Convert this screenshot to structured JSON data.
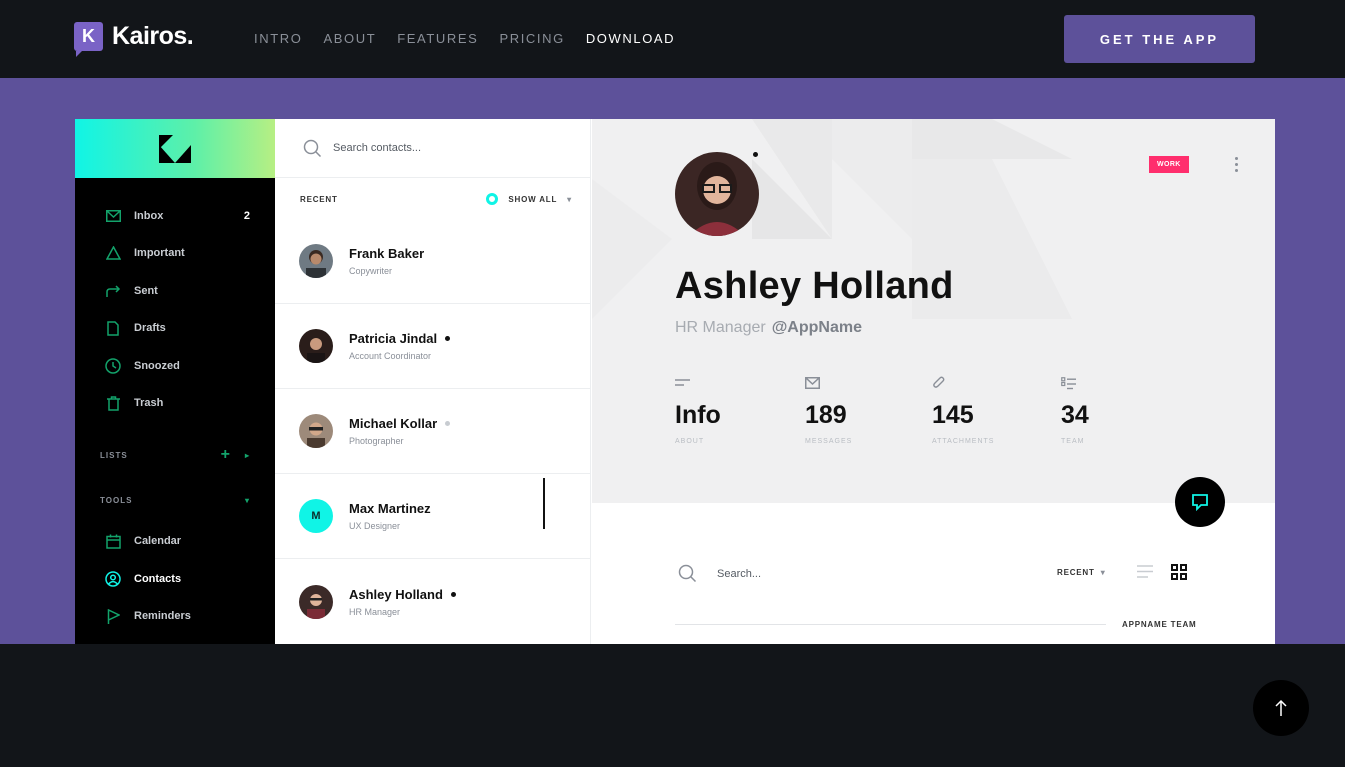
{
  "brand": {
    "badge": "K",
    "name": "Kairos."
  },
  "nav": [
    {
      "label": "INTRO"
    },
    {
      "label": "ABOUT"
    },
    {
      "label": "FEATURES"
    },
    {
      "label": "PRICING"
    },
    {
      "label": "DOWNLOAD"
    }
  ],
  "cta_label": "GET THE APP",
  "colors": {
    "accent": "#5d519a",
    "aqua": "#10f4e6",
    "green": "#13a36b",
    "tag": "#ff2e6d",
    "dark": "#121519"
  },
  "sidebar": {
    "items": [
      {
        "label": "Inbox",
        "count": "2",
        "icon": "mail-icon"
      },
      {
        "label": "Important",
        "icon": "triangle-icon"
      },
      {
        "label": "Sent",
        "icon": "forward-icon"
      },
      {
        "label": "Drafts",
        "icon": "document-icon"
      },
      {
        "label": "Snoozed",
        "icon": "clock-icon"
      },
      {
        "label": "Trash",
        "icon": "trash-icon"
      }
    ],
    "lists_label": "LISTS",
    "tools_label": "TOOLS",
    "tools": [
      {
        "label": "Calendar",
        "icon": "calendar-icon"
      },
      {
        "label": "Contacts",
        "icon": "user-circle-icon"
      },
      {
        "label": "Reminders",
        "icon": "flag-icon"
      }
    ]
  },
  "contacts": {
    "search_placeholder": "Search contacts...",
    "recent_label": "RECENT",
    "show_all_label": "SHOW ALL",
    "list": [
      {
        "name": "Frank Baker",
        "role": "Copywriter"
      },
      {
        "name": "Patricia Jindal",
        "role": "Account Coordinator"
      },
      {
        "name": "Michael Kollar",
        "role": "Photographer"
      },
      {
        "name": "Max Martinez",
        "role": "UX Designer",
        "initial": "M"
      },
      {
        "name": "Ashley Holland",
        "role": "HR Manager"
      }
    ]
  },
  "profile": {
    "name": "Ashley Holland",
    "role": "HR Manager",
    "handle": "@AppName",
    "tag": "WORK",
    "stats": [
      {
        "value": "Info",
        "label": "ABOUT",
        "icon": "lines-icon"
      },
      {
        "value": "189",
        "label": "MESSAGES",
        "icon": "mail-icon"
      },
      {
        "value": "145",
        "label": "ATTACHMENTS",
        "icon": "paperclip-icon"
      },
      {
        "value": "34",
        "label": "TEAM",
        "icon": "checklist-icon"
      }
    ]
  },
  "bottom": {
    "search_placeholder": "Search...",
    "recent_label": "RECENT",
    "team_label": "APPNAME TEAM"
  }
}
